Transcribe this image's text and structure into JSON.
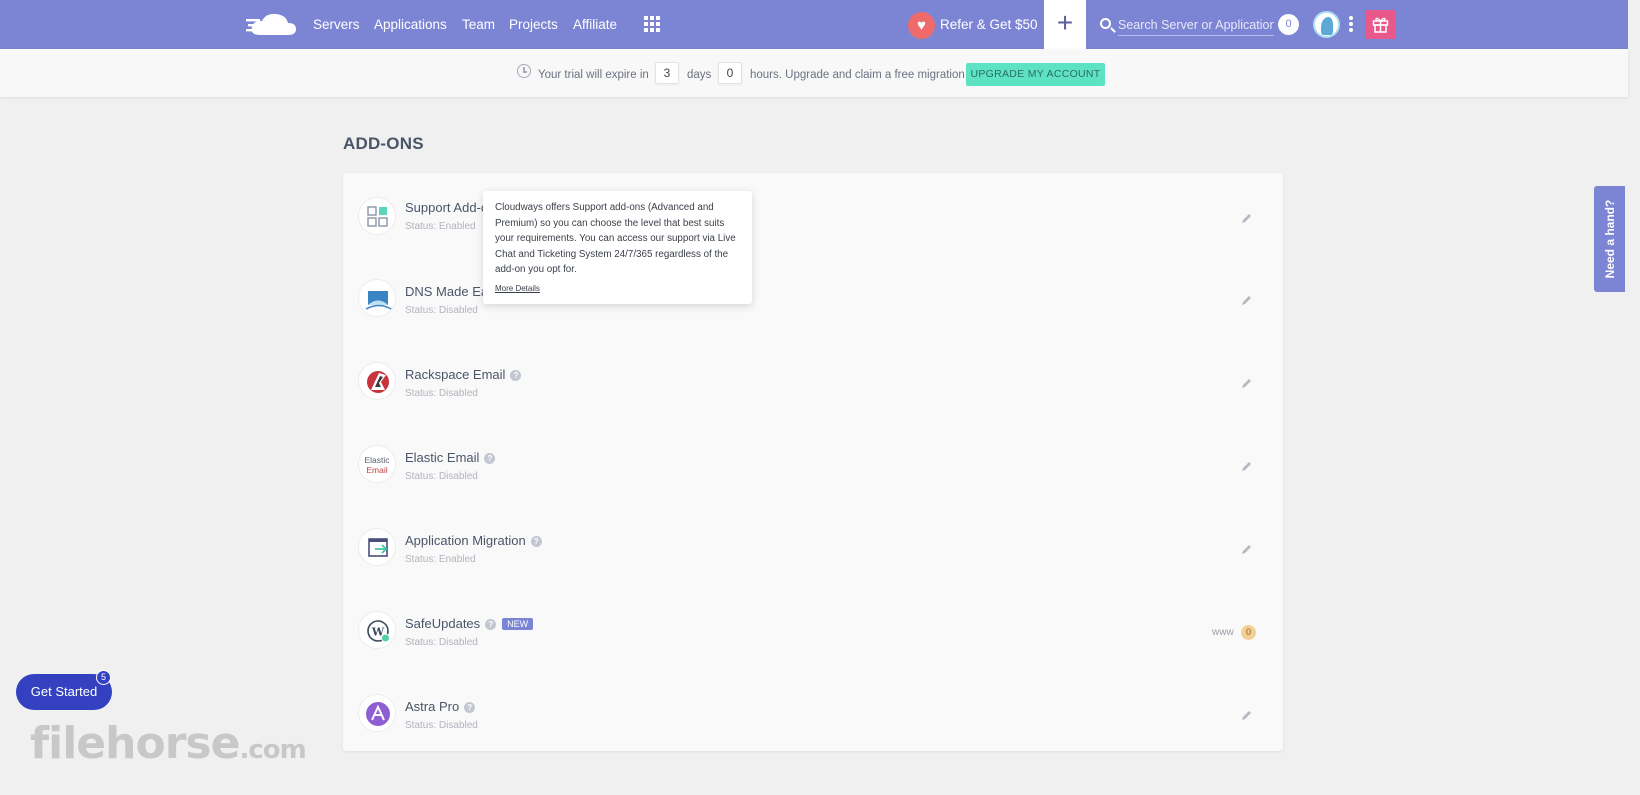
{
  "nav": {
    "links": [
      "Servers",
      "Applications",
      "Team",
      "Projects",
      "Affiliate"
    ],
    "refer_label": "Refer & Get $50",
    "plus_label": "+",
    "search_placeholder": "Search Server or Application",
    "notification_count": "0",
    "brand_color": "#7c84d4"
  },
  "trial": {
    "prefix": "Your trial will expire in",
    "days_value": "3",
    "days_label": "days",
    "hours_value": "0",
    "suffix": "hours. Upgrade and claim a free migration",
    "upgrade_label": "UPGRADE MY ACCOUNT"
  },
  "page": {
    "title": "ADD-ONS"
  },
  "addons": [
    {
      "name": "Support Add-ons",
      "status": "Status: Enabled",
      "icon": "support-grid-icon",
      "action": "edit"
    },
    {
      "name": "DNS Made Easy",
      "status": "Status: Disabled",
      "icon": "dns-icon",
      "action": "edit"
    },
    {
      "name": "Rackspace Email",
      "status": "Status: Disabled",
      "icon": "rackspace-icon",
      "action": "edit"
    },
    {
      "name": "Elastic Email",
      "status": "Status: Disabled",
      "icon": "elastic-email-icon",
      "icon_text_1": "Elastic",
      "icon_text_2": "Email",
      "action": "edit"
    },
    {
      "name": "Application Migration",
      "status": "Status: Enabled",
      "icon": "migration-icon",
      "action": "edit"
    },
    {
      "name": "SafeUpdates",
      "status": "Status: Disabled",
      "icon": "wordpress-icon",
      "badge": "NEW",
      "www_label": "www",
      "www_count": "0"
    },
    {
      "name": "Astra Pro",
      "status": "Status: Disabled",
      "icon": "astra-icon",
      "action": "edit"
    }
  ],
  "tooltip": {
    "text": "Cloudways offers Support add-ons (Advanced and Premium) so you can choose the level that best suits your requirements. You can access our support via Live Chat and Ticketing System 24/7/365 regardless of the add-on you opt for.",
    "link": "More Details"
  },
  "help_tab": "Need a hand?",
  "get_started": {
    "label": "Get Started",
    "count": "5"
  },
  "watermark": {
    "main": "filehorse",
    "suffix": ".com"
  }
}
